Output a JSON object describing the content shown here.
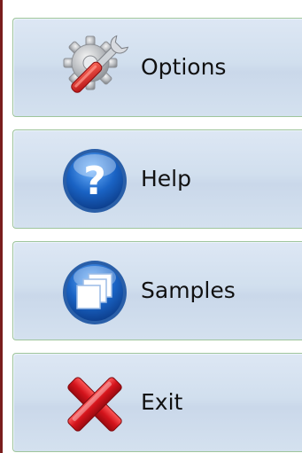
{
  "menu": {
    "items": [
      {
        "label": "Options",
        "icon": "settings-wrench-icon"
      },
      {
        "label": "Help",
        "icon": "help-icon"
      },
      {
        "label": "Samples",
        "icon": "windows-icon"
      },
      {
        "label": "Exit",
        "icon": "close-icon"
      }
    ]
  },
  "colors": {
    "button_background": "#d1dfee",
    "button_border": "#9fc59c",
    "left_border": "#7a1e1e",
    "help_icon_blue": "#1a63c4",
    "exit_icon_red": "#d4141c"
  }
}
